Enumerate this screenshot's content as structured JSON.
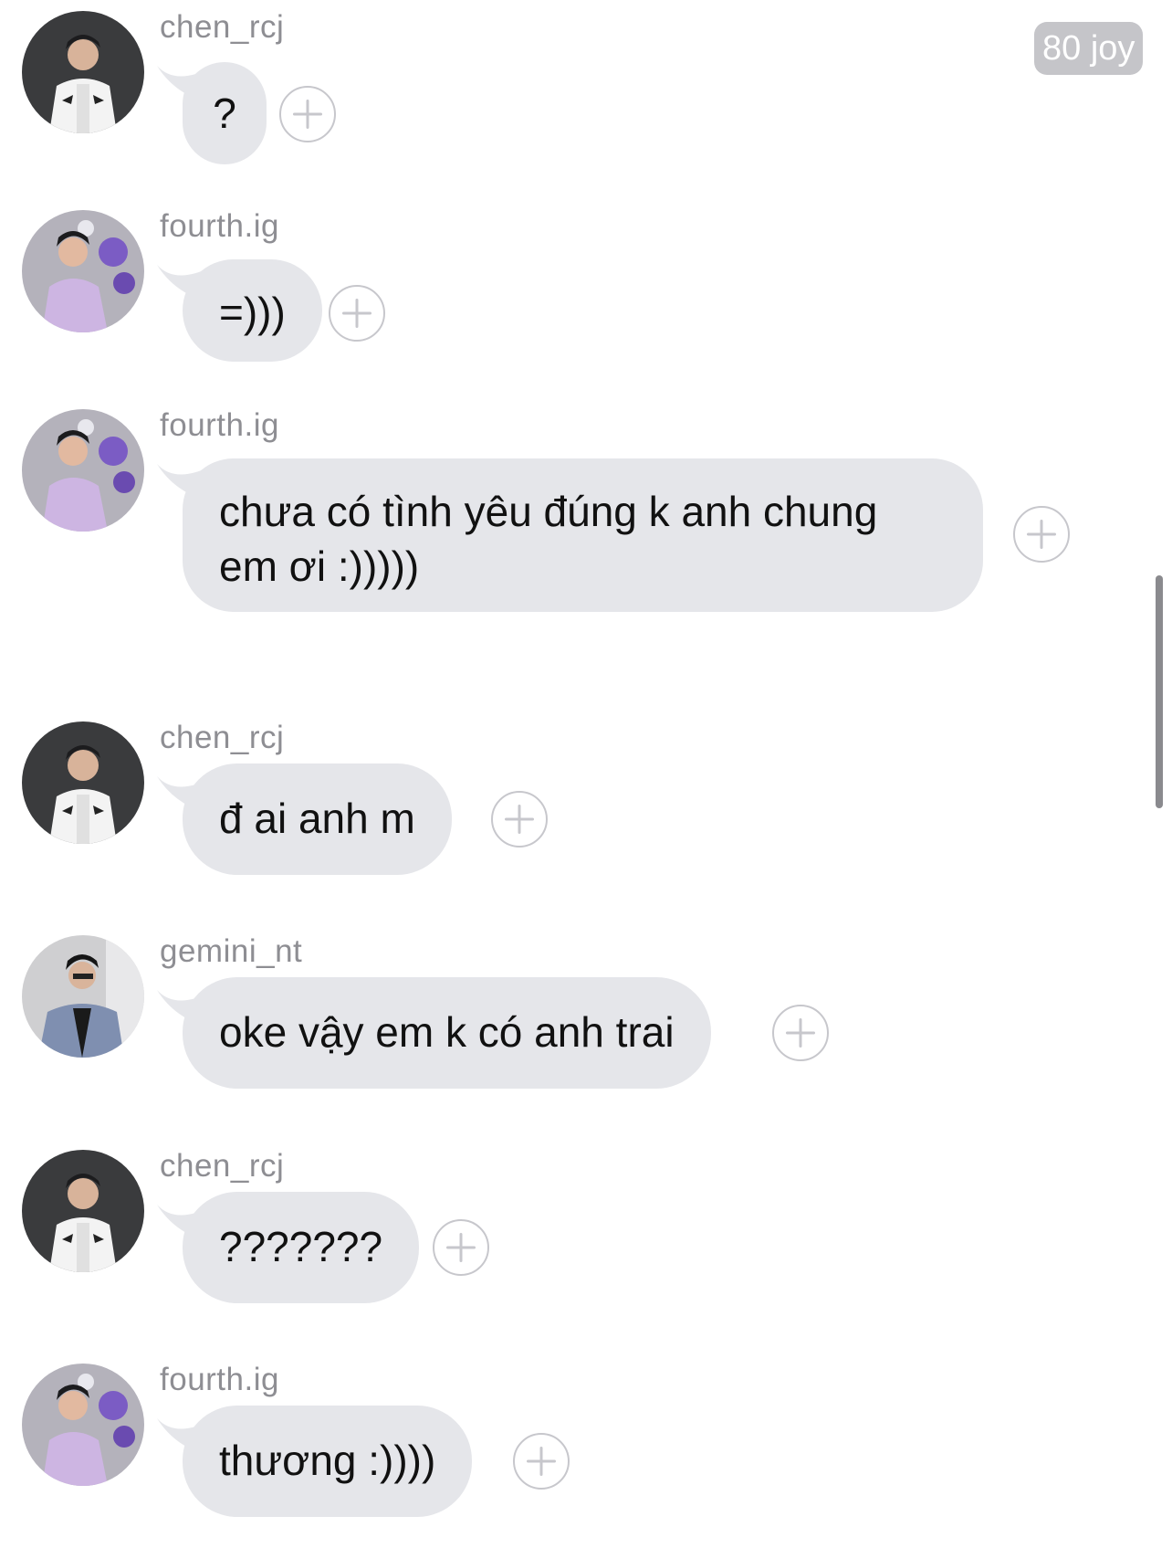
{
  "badge": {
    "text": "80 joy"
  },
  "messages": [
    {
      "username": "chen_rcj",
      "text": "?",
      "avatar": "chen-avatar"
    },
    {
      "username": "fourth.ig",
      "text": "=)))",
      "avatar": "fourth-avatar"
    },
    {
      "username": "fourth.ig",
      "text": "chưa có tình yêu đúng k anh chung em ơi :)))))",
      "avatar": "fourth-avatar"
    },
    {
      "username": "chen_rcj",
      "text": "đ ai anh m",
      "avatar": "chen-avatar"
    },
    {
      "username": "gemini_nt",
      "text": "oke vậy em k có anh trai",
      "avatar": "gemini-avatar"
    },
    {
      "username": "chen_rcj",
      "text": "???????",
      "avatar": "chen-avatar"
    },
    {
      "username": "fourth.ig",
      "text": "thương :))))",
      "avatar": "fourth-avatar"
    }
  ],
  "colors": {
    "bubble": "#e5e6ea",
    "username": "#8e8e93",
    "plus": "#c7c7cc",
    "badge": "#c5c5c9"
  },
  "icons": {
    "react": "add-reaction-icon"
  }
}
